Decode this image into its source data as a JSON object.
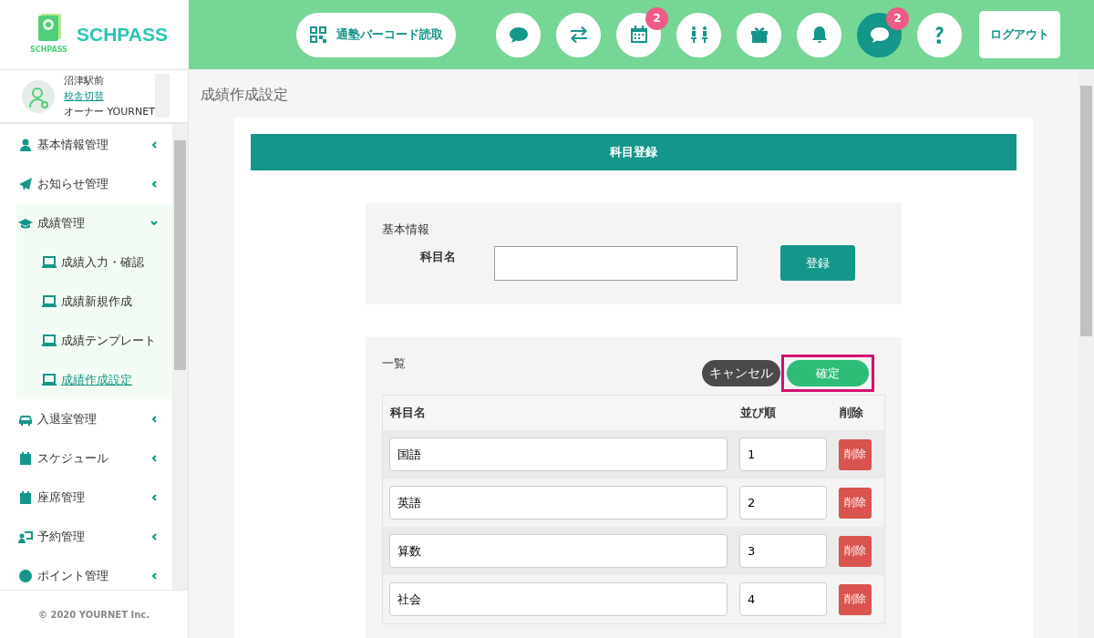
{
  "header": {
    "logo_text": "SCHPASS",
    "logo_caption": "SCHPASS",
    "barcode_button": "通塾バーコード読取",
    "icons": [
      {
        "kind": "chat",
        "active": false
      },
      {
        "kind": "swap",
        "active": false
      },
      {
        "kind": "calendar",
        "badge": "2",
        "active": false
      },
      {
        "kind": "seats",
        "active": false
      },
      {
        "kind": "gift",
        "active": false
      },
      {
        "kind": "bell",
        "active": false
      },
      {
        "kind": "chat",
        "badge": "2",
        "active": true
      },
      {
        "kind": "help",
        "active": false
      }
    ],
    "logout": "ログアウト"
  },
  "profile": {
    "school": "沼津駅前",
    "switch_link": "校舎切替",
    "owner": "オーナー YOURNET"
  },
  "sidebar": {
    "items": [
      {
        "kind": "user",
        "label": "基本情報管理",
        "expanded": false
      },
      {
        "kind": "plane",
        "label": "お知らせ管理",
        "expanded": false
      },
      {
        "kind": "cap",
        "label": "成績管理",
        "expanded": true,
        "children": [
          {
            "label": "成績入力・確認",
            "selected": false
          },
          {
            "label": "成績新規作成",
            "selected": false
          },
          {
            "label": "成績テンプレート",
            "selected": false
          },
          {
            "label": "成績作成設定",
            "selected": true
          }
        ]
      },
      {
        "kind": "car",
        "label": "入退室管理",
        "expanded": false
      },
      {
        "kind": "schedule",
        "label": "スケジュール",
        "expanded": false
      },
      {
        "kind": "seats",
        "label": "座席管理",
        "expanded": false
      },
      {
        "kind": "reservation",
        "label": "予約管理",
        "expanded": false
      },
      {
        "kind": "point",
        "label": "ポイント管理",
        "expanded": false
      }
    ],
    "footer": "© 2020 YOURNET Inc."
  },
  "page_title": "成績作成設定",
  "card": {
    "title": "科目登録",
    "basic": {
      "heading": "基本情報",
      "field_label": "科目名",
      "register_button": "登録"
    },
    "list": {
      "heading": "一覧",
      "cancel_button": "キャンセル",
      "confirm_button": "確定",
      "confirm_highlighted": true,
      "columns": [
        "科目名",
        "並び順",
        "削除"
      ],
      "rows": [
        {
          "name": "国語",
          "order": "1",
          "delete": "削除"
        },
        {
          "name": "英語",
          "order": "2",
          "delete": "削除"
        },
        {
          "name": "算数",
          "order": "3",
          "delete": "削除"
        },
        {
          "name": "社会",
          "order": "4",
          "delete": "削除"
        }
      ]
    }
  }
}
